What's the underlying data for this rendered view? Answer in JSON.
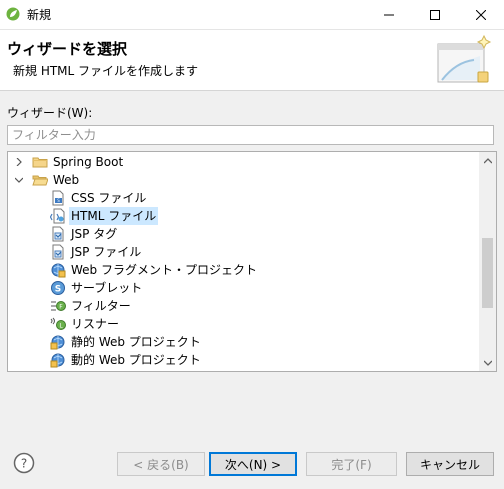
{
  "window": {
    "title": "新規",
    "app_icon": "spring-leaf-icon"
  },
  "header": {
    "title": "ウィザードを選択",
    "description": "新規 HTML ファイルを作成します",
    "banner_icon": "wizard-banner-icon"
  },
  "wizards": {
    "label": "ウィザード(W):",
    "filter_placeholder": "フィルター入力",
    "filter_value": ""
  },
  "tree": {
    "items": [
      {
        "label": "Spring Boot",
        "icon": "folder-icon",
        "expandable": true,
        "expanded": false,
        "level": 0
      },
      {
        "label": "Web",
        "icon": "folder-icon",
        "expandable": true,
        "expanded": true,
        "level": 0
      },
      {
        "label": "CSS ファイル",
        "icon": "css-file-icon",
        "level": 1
      },
      {
        "label": "HTML ファイル",
        "icon": "html-file-icon",
        "level": 1,
        "selected": true
      },
      {
        "label": "JSP タグ",
        "icon": "jsp-tag-icon",
        "level": 1
      },
      {
        "label": "JSP ファイル",
        "icon": "jsp-file-icon",
        "level": 1
      },
      {
        "label": "Web フラグメント・プロジェクト",
        "icon": "web-fragment-project-icon",
        "level": 1
      },
      {
        "label": "サーブレット",
        "icon": "servlet-icon",
        "level": 1
      },
      {
        "label": "フィルター",
        "icon": "filter-icon",
        "level": 1
      },
      {
        "label": "リスナー",
        "icon": "listener-icon",
        "level": 1
      },
      {
        "label": "静的 Web プロジェクト",
        "icon": "static-web-project-icon",
        "level": 1
      },
      {
        "label": "動的 Web プロジェクト",
        "icon": "dynamic-web-project-icon",
        "level": 1
      }
    ]
  },
  "buttons": {
    "back": "< 戻る(B)",
    "next": "次へ(N) >",
    "finish": "完了(F)",
    "cancel": "キャンセル"
  },
  "colors": {
    "selection": "#cce8ff",
    "default_button_border": "#0078d7"
  }
}
